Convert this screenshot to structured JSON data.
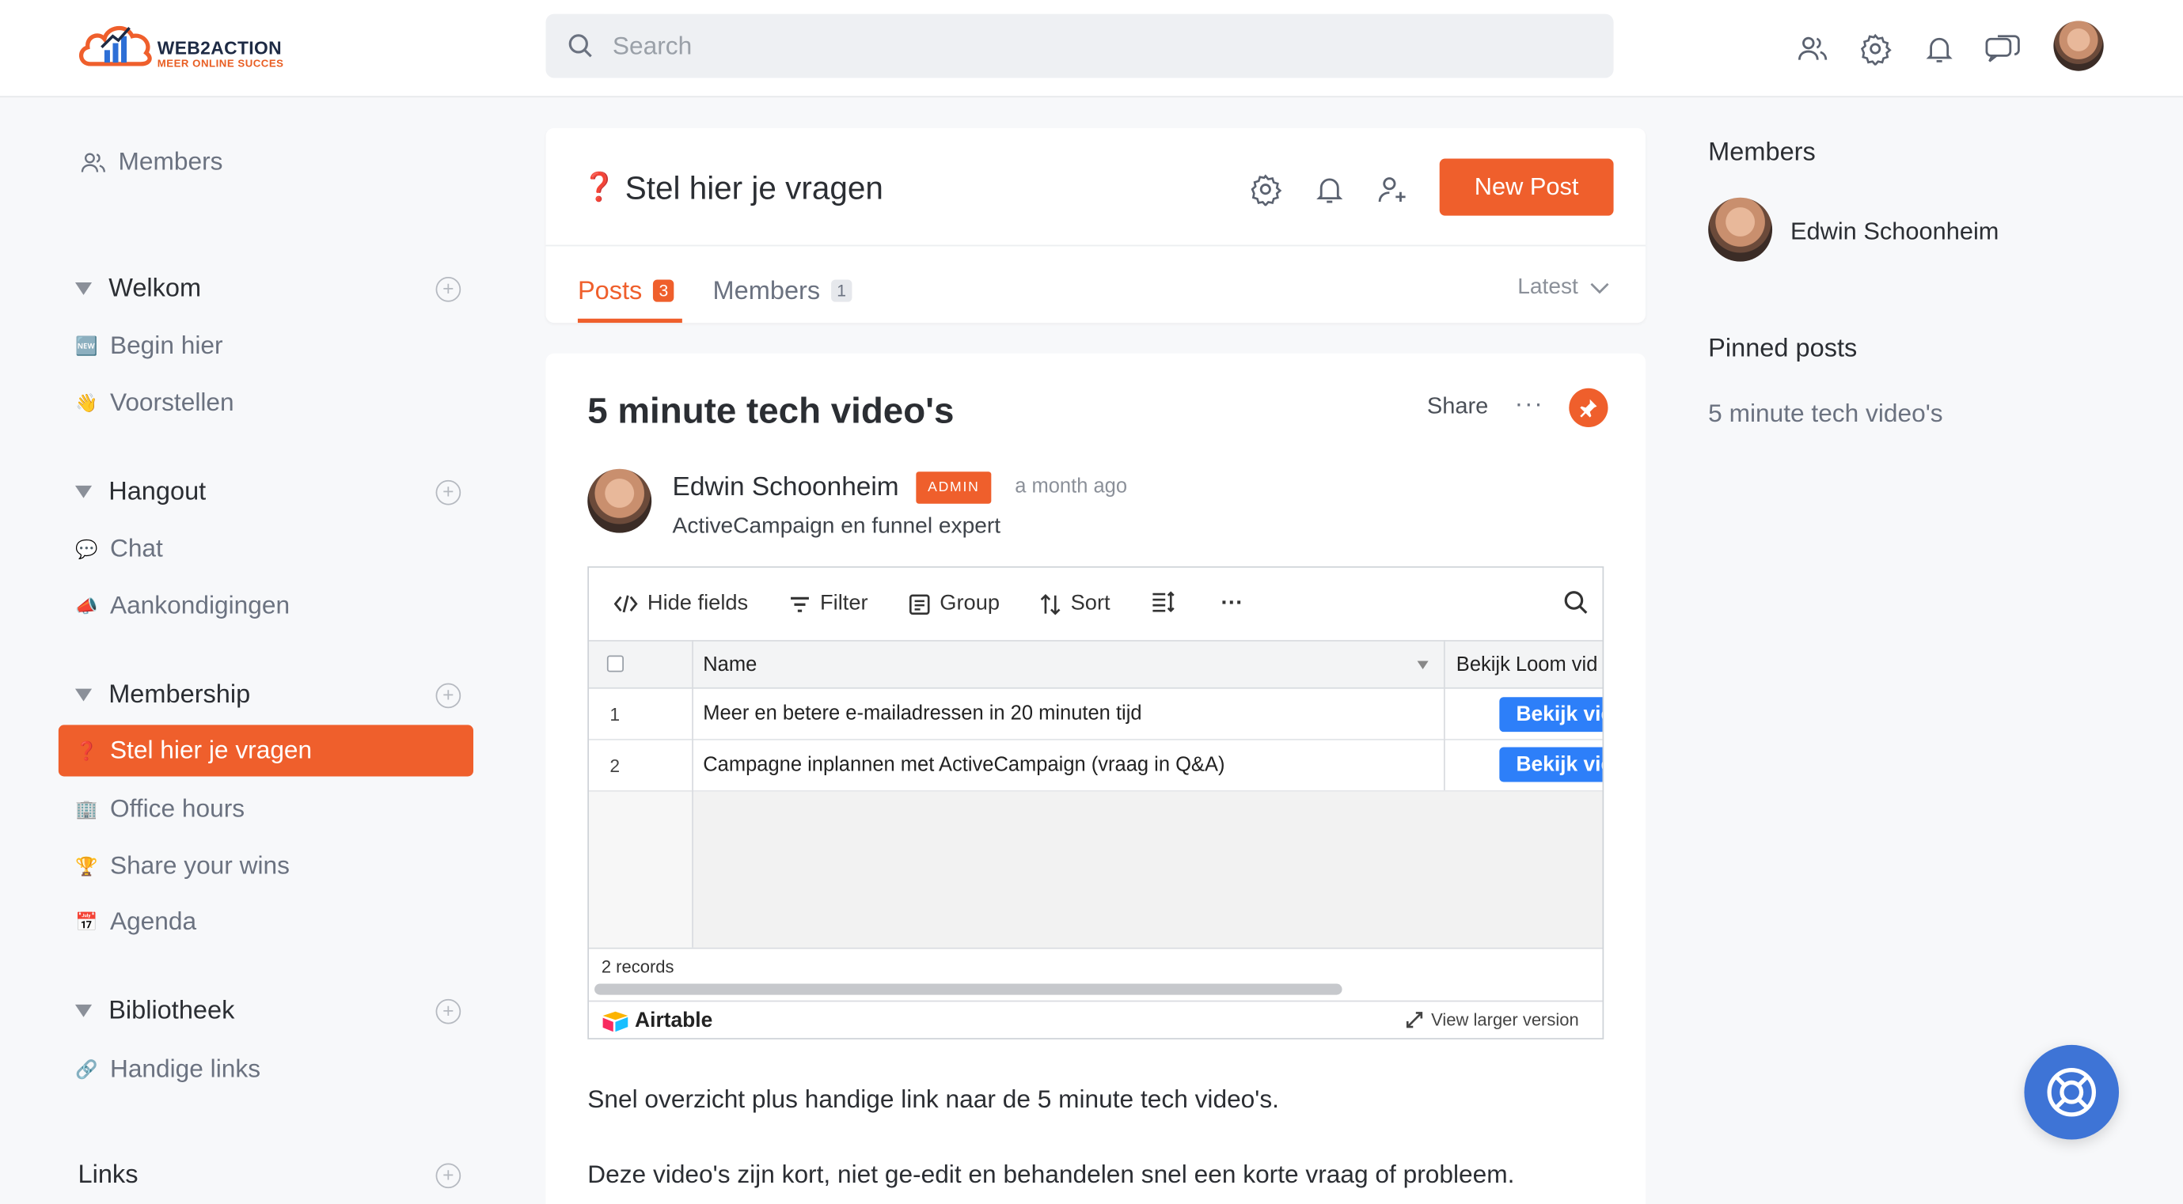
{
  "brand": {
    "name": "WEB2ACTION",
    "tagline": "MEER ONLINE SUCCES",
    "accent": "#ef5f2c",
    "link_blue": "#2d7ff9"
  },
  "search": {
    "placeholder": "Search"
  },
  "header_icons": [
    "members-icon",
    "settings-icon",
    "notifications-icon",
    "messages-icon"
  ],
  "sidebar": {
    "members_link": "Members",
    "sections": [
      {
        "title": "Welkom",
        "items": [
          {
            "emoji": "🆕",
            "label": "Begin hier"
          },
          {
            "emoji": "👋",
            "label": "Voorstellen"
          }
        ]
      },
      {
        "title": "Hangout",
        "items": [
          {
            "emoji": "💬",
            "label": "Chat"
          },
          {
            "emoji": "📣",
            "label": "Aankondigingen"
          }
        ]
      },
      {
        "title": "Membership",
        "items": [
          {
            "emoji": "❓",
            "label": "Stel hier je vragen"
          },
          {
            "emoji": "🏢",
            "label": "Office hours"
          },
          {
            "emoji": "🏆",
            "label": "Share your wins"
          },
          {
            "emoji": "📅",
            "label": "Agenda"
          }
        ]
      },
      {
        "title": "Bibliotheek",
        "items": [
          {
            "emoji": "🔗",
            "label": "Handige links"
          }
        ]
      },
      {
        "title": "Links",
        "items": []
      }
    ]
  },
  "space": {
    "emoji": "❓",
    "title": "Stel hier je vragen",
    "new_post": "New Post",
    "tabs": [
      {
        "label": "Posts",
        "count": "3"
      },
      {
        "label": "Members",
        "count": "1"
      }
    ],
    "sort": "Latest"
  },
  "post": {
    "title": "5 minute tech video's",
    "share": "Share",
    "more": "···",
    "author": "Edwin Schoonheim",
    "role_badge": "ADMIN",
    "time": "a month ago",
    "headline": "ActiveCampaign en funnel expert",
    "body": [
      "Snel overzicht plus handige link naar de 5 minute tech video's.",
      "Deze video's zijn kort, niet ge-edit en behandelen snel een korte vraag of probleem."
    ]
  },
  "airtable": {
    "toolbar": {
      "hide": "Hide fields",
      "filter": "Filter",
      "group": "Group",
      "sort": "Sort",
      "more": "···"
    },
    "columns": [
      "Name",
      "Bekijk Loom vid"
    ],
    "rows": [
      {
        "num": "1",
        "name": "Meer en betere e-mailadressen in 20 minuten tijd",
        "button": "Bekijk video"
      },
      {
        "num": "2",
        "name": "Campagne inplannen met ActiveCampaign (vraag in Q&A)",
        "button": "Bekijk video"
      }
    ],
    "records": "2 records",
    "brand": "Airtable",
    "larger": "View larger version"
  },
  "right": {
    "members_title": "Members",
    "member_name": "Edwin Schoonheim",
    "pinned_title": "Pinned posts",
    "pinned_post": "5 minute tech video's"
  }
}
